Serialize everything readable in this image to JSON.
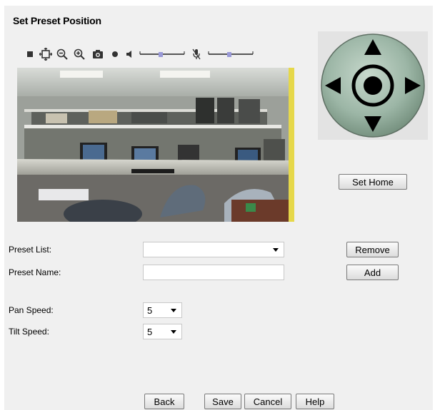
{
  "page": {
    "title": "Set Preset Position"
  },
  "toolbar": {
    "items": [
      {
        "name": "stop-icon"
      },
      {
        "name": "fit-screen-icon"
      },
      {
        "name": "zoom-out-icon"
      },
      {
        "name": "zoom-in-icon"
      },
      {
        "name": "snapshot-icon"
      },
      {
        "name": "record-icon"
      },
      {
        "name": "speaker-icon"
      },
      {
        "name": "volume-slider"
      },
      {
        "name": "microphone-muted-icon"
      },
      {
        "name": "mic-volume-slider"
      }
    ]
  },
  "ptz": {
    "up": "up-arrow-icon",
    "down": "down-arrow-icon",
    "left": "left-arrow-icon",
    "right": "right-arrow-icon",
    "home": "home-center-icon",
    "set_home_label": "Set Home"
  },
  "form": {
    "preset_list_label": "Preset List:",
    "preset_list_value": "",
    "preset_name_label": "Preset Name:",
    "preset_name_value": "",
    "pan_speed_label": "Pan Speed:",
    "pan_speed_value": "5",
    "tilt_speed_label": "Tilt Speed:",
    "tilt_speed_value": "5",
    "remove_label": "Remove",
    "add_label": "Add"
  },
  "footer": {
    "back_label": "Back",
    "save_label": "Save",
    "cancel_label": "Cancel",
    "help_label": "Help"
  },
  "colors": {
    "panel_bg": "#f0f0f0",
    "joystick": "#94b0a0",
    "slider_thumb": "#9a9ad8"
  }
}
